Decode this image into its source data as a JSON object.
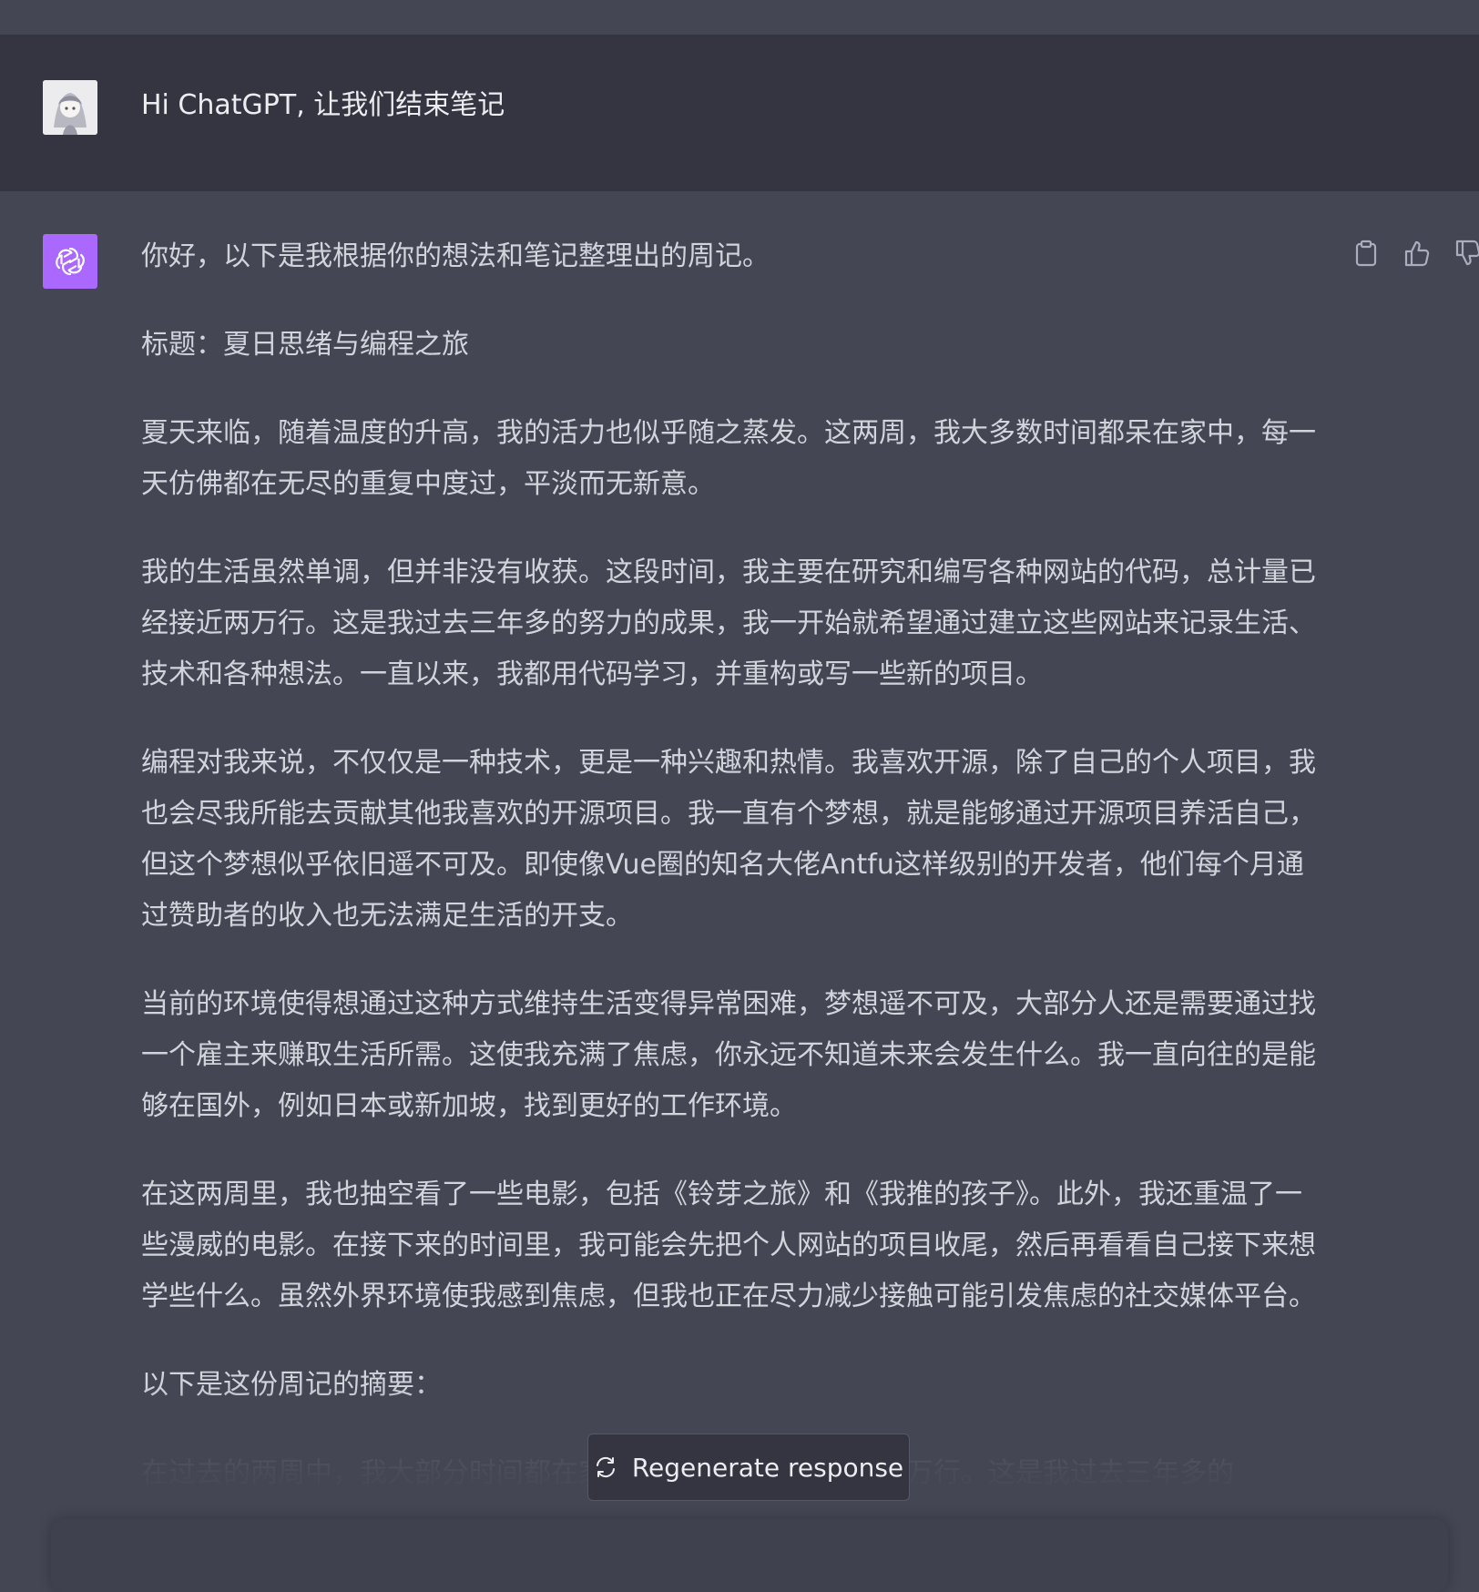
{
  "conversation": {
    "user_message": "Hi ChatGPT, 让我们结束笔记",
    "assistant_paragraphs": [
      "你好，以下是我根据你的想法和笔记整理出的周记。",
      "标题：夏日思绪与编程之旅",
      "夏天来临，随着温度的升高，我的活力也似乎随之蒸发。这两周，我大多数时间都呆在家中，每一天仿佛都在无尽的重复中度过，平淡而无新意。",
      "我的生活虽然单调，但并非没有收获。这段时间，我主要在研究和编写各种网站的代码，总计量已经接近两万行。这是我过去三年多的努力的成果，我一开始就希望通过建立这些网站来记录生活、技术和各种想法。一直以来，我都用代码学习，并重构或写一些新的项目。",
      "编程对我来说，不仅仅是一种技术，更是一种兴趣和热情。我喜欢开源，除了自己的个人项目，我也会尽我所能去贡献其他我喜欢的开源项目。我一直有个梦想，就是能够通过开源项目养活自己，但这个梦想似乎依旧遥不可及。即使像Vue圈的知名大佬Antfu这样级别的开发者，他们每个月通过赞助者的收入也无法满足生活的开支。",
      "当前的环境使得想通过这种方式维持生活变得异常困难，梦想遥不可及，大部分人还是需要通过找一个雇主来赚取生活所需。这使我充满了焦虑，你永远不知道未来会发生什么。我一直向往的是能够在国外，例如日本或新加坡，找到更好的工作环境。",
      "在这两周里，我也抽空看了一些电影，包括《铃芽之旅》和《我推的孩子》。此外，我还重温了一些漫威的电影。在接下来的时间里，我可能会先把个人网站的项目收尾，然后再看看自己接下来想学些什么。虽然外界环境使我感到焦虑，但我也正在尽力减少接触可能引发焦虑的社交媒体平台。",
      "以下是这份周记的摘要：",
      "在过去的两周中，我大部分时间都在家中写代码，总计已接近两万行。这是我过去三年多的"
    ]
  },
  "actions": {
    "copy_icon": "clipboard-icon",
    "like_icon": "thumbs-up-icon",
    "dislike_icon": "thumbs-down-icon"
  },
  "regenerate": {
    "label": "Regenerate response",
    "icon": "refresh-icon"
  },
  "colors": {
    "user_row_bg": "#343541",
    "assistant_row_bg": "#444654",
    "gpt_avatar_bg": "#ab68ff",
    "text": "#d1d5db"
  }
}
